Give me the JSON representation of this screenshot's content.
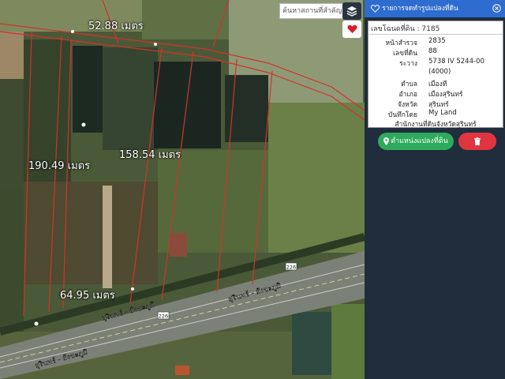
{
  "map": {
    "distances": [
      "52.88 เมตร",
      "190.49 เมตร",
      "158.54 เมตร",
      "64.95 เมตร"
    ],
    "road_labels": [
      "สุรินทร์ - สังขะภูมิ",
      "สุรินทร์ - สังขะภูมิ",
      "สุรินทร์ - สังขะภูมิ"
    ],
    "route_number": "226",
    "route_number_2": "226"
  },
  "search": {
    "placeholder": "ค้นหาสถานที่สำคัญ"
  },
  "panel": {
    "header": "รายการจดทำรูปแปลงที่ดิน",
    "deed": "เลขโฉนดที่ดิน : 7185",
    "rows": [
      {
        "label": "หน้าสำรวจ",
        "value": "2835"
      },
      {
        "label": "เลขที่ดิน",
        "value": "88"
      },
      {
        "label": "ระวาง",
        "value": "5738 IV 5244-00"
      },
      {
        "label": "",
        "value": "(4000)"
      },
      {
        "label": "ตำบล",
        "value": "เมืองที"
      },
      {
        "label": "อำเภอ",
        "value": "เมืองสุรินทร์"
      },
      {
        "label": "จังหวัด",
        "value": "สุรินทร์"
      },
      {
        "label": "บันทึกโดย",
        "value": "My Land"
      }
    ],
    "office": "สำนักงานที่ดินจังหวัดสุรินทร์",
    "locate_button": "ตำแหน่งแปลงที่ดิน"
  },
  "colors": {
    "panel_bg": "#1f2d3d",
    "header_bg": "#2f6cd0",
    "locate_btn": "#2eaa5c",
    "delete_btn": "#e0353f",
    "boundary": "#d2322d"
  }
}
